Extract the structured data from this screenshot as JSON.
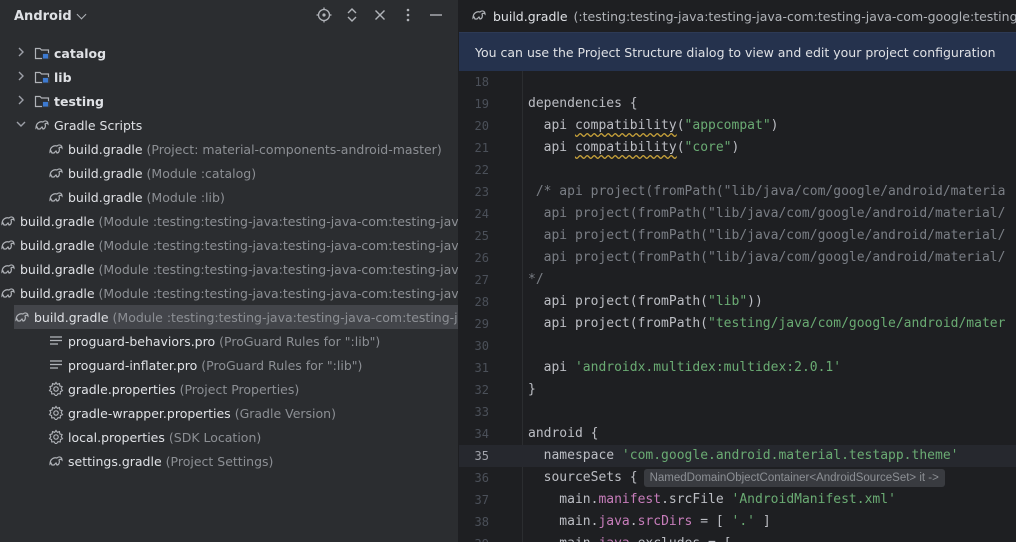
{
  "project_panel": {
    "title": "Android",
    "header_icons": [
      "locate-icon",
      "expand-collapse-icon",
      "close-icon",
      "more-options-icon",
      "minimize-icon"
    ],
    "items": [
      {
        "label": "catalog",
        "hint": "",
        "indent": 0,
        "arrow": "›",
        "icon": "module-folder-icon",
        "bold": true,
        "selected": false
      },
      {
        "label": "lib",
        "hint": "",
        "indent": 0,
        "arrow": "›",
        "icon": "module-folder-icon",
        "bold": true,
        "selected": false
      },
      {
        "label": "testing",
        "hint": "",
        "indent": 0,
        "arrow": "›",
        "icon": "module-folder-icon",
        "bold": true,
        "selected": false
      },
      {
        "label": "Gradle Scripts",
        "hint": "",
        "indent": 0,
        "arrow": "⌄",
        "icon": "gradle-icon",
        "bold": false,
        "selected": false
      },
      {
        "label": "build.gradle",
        "hint": "(Project: material-components-android-master)",
        "indent": 1,
        "arrow": "",
        "icon": "gradle-icon",
        "bold": false,
        "selected": false
      },
      {
        "label": "build.gradle",
        "hint": "(Module :catalog)",
        "indent": 1,
        "arrow": "",
        "icon": "gradle-icon",
        "bold": false,
        "selected": false
      },
      {
        "label": "build.gradle",
        "hint": "(Module :lib)",
        "indent": 1,
        "arrow": "",
        "icon": "gradle-icon",
        "bold": false,
        "selected": false
      },
      {
        "label": "build.gradle",
        "hint": "(Module :testing:testing-java:testing-java-com:testing-java-",
        "indent": 1,
        "arrow": "",
        "icon": "gradle-icon",
        "bold": false,
        "selected": false
      },
      {
        "label": "build.gradle",
        "hint": "(Module :testing:testing-java:testing-java-com:testing-java-",
        "indent": 1,
        "arrow": "",
        "icon": "gradle-icon",
        "bold": false,
        "selected": false
      },
      {
        "label": "build.gradle",
        "hint": "(Module :testing:testing-java:testing-java-com:testing-java-",
        "indent": 1,
        "arrow": "",
        "icon": "gradle-icon",
        "bold": false,
        "selected": false
      },
      {
        "label": "build.gradle",
        "hint": "(Module :testing:testing-java:testing-java-com:testing-java-",
        "indent": 1,
        "arrow": "",
        "icon": "gradle-icon",
        "bold": false,
        "selected": false
      },
      {
        "label": "build.gradle",
        "hint": "(Module :testing:testing-java:testing-java-com:testing-java-",
        "indent": 1,
        "arrow": "",
        "icon": "gradle-icon",
        "bold": false,
        "selected": true
      },
      {
        "label": "proguard-behaviors.pro",
        "hint": "(ProGuard Rules for \":lib\")",
        "indent": 1,
        "arrow": "",
        "icon": "text-file-icon",
        "bold": false,
        "selected": false
      },
      {
        "label": "proguard-inflater.pro",
        "hint": "(ProGuard Rules for \":lib\")",
        "indent": 1,
        "arrow": "",
        "icon": "text-file-icon",
        "bold": false,
        "selected": false
      },
      {
        "label": "gradle.properties",
        "hint": "(Project Properties)",
        "indent": 1,
        "arrow": "",
        "icon": "settings-gear-icon",
        "bold": false,
        "selected": false
      },
      {
        "label": "gradle-wrapper.properties",
        "hint": "(Gradle Version)",
        "indent": 1,
        "arrow": "",
        "icon": "settings-gear-icon",
        "bold": false,
        "selected": false
      },
      {
        "label": "local.properties",
        "hint": "(SDK Location)",
        "indent": 1,
        "arrow": "",
        "icon": "settings-gear-icon",
        "bold": false,
        "selected": false
      },
      {
        "label": "settings.gradle",
        "hint": "(Project Settings)",
        "indent": 1,
        "arrow": "",
        "icon": "gradle-icon",
        "bold": false,
        "selected": false
      }
    ]
  },
  "editor": {
    "tab_title": "build.gradle",
    "tab_path": "(:testing:testing-java:testing-java-com:testing-java-com-google:testing-java-com-goo",
    "banner": "You can use the Project Structure dialog to view and edit your project configuration",
    "current_line": 35,
    "lines": [
      {
        "num": "18",
        "segments": []
      },
      {
        "num": "19",
        "segments": [
          {
            "t": "dependencies {",
            "c": ""
          }
        ]
      },
      {
        "num": "20",
        "segments": [
          {
            "t": "  api ",
            "c": ""
          },
          {
            "t": "compatibility",
            "c": "squig"
          },
          {
            "t": "(",
            "c": ""
          },
          {
            "t": "\"appcompat\"",
            "c": "str"
          },
          {
            "t": ")",
            "c": ""
          }
        ]
      },
      {
        "num": "21",
        "segments": [
          {
            "t": "  api ",
            "c": ""
          },
          {
            "t": "compatibility",
            "c": "squig"
          },
          {
            "t": "(",
            "c": ""
          },
          {
            "t": "\"core\"",
            "c": "str"
          },
          {
            "t": ")",
            "c": ""
          }
        ]
      },
      {
        "num": "22",
        "segments": []
      },
      {
        "num": "23",
        "segments": [
          {
            "t": " /* api project(fromPath(\"lib/java/com/google/android/materia",
            "c": "cmt"
          }
        ]
      },
      {
        "num": "24",
        "segments": [
          {
            "t": "  api project(fromPath(\"lib/java/com/google/android/material/",
            "c": "cmt"
          }
        ]
      },
      {
        "num": "25",
        "segments": [
          {
            "t": "  api project(fromPath(\"lib/java/com/google/android/material/",
            "c": "cmt"
          }
        ]
      },
      {
        "num": "26",
        "segments": [
          {
            "t": "  api project(fromPath(\"lib/java/com/google/android/material/",
            "c": "cmt"
          }
        ]
      },
      {
        "num": "27",
        "segments": [
          {
            "t": "*/",
            "c": "cmt"
          }
        ]
      },
      {
        "num": "28",
        "segments": [
          {
            "t": "  api project(fromPath(",
            "c": ""
          },
          {
            "t": "\"lib\"",
            "c": "str"
          },
          {
            "t": "))",
            "c": ""
          }
        ]
      },
      {
        "num": "29",
        "segments": [
          {
            "t": "  api project(fromPath(",
            "c": ""
          },
          {
            "t": "\"testing/java/com/google/android/mater",
            "c": "str"
          }
        ]
      },
      {
        "num": "30",
        "segments": []
      },
      {
        "num": "31",
        "segments": [
          {
            "t": "  api ",
            "c": ""
          },
          {
            "t": "'androidx.multidex:multidex:2.0.1'",
            "c": "str"
          }
        ]
      },
      {
        "num": "32",
        "segments": [
          {
            "t": "}",
            "c": ""
          }
        ]
      },
      {
        "num": "33",
        "segments": []
      },
      {
        "num": "34",
        "segments": [
          {
            "t": "android {",
            "c": ""
          }
        ]
      },
      {
        "num": "35",
        "segments": [
          {
            "t": "  namespace ",
            "c": ""
          },
          {
            "t": "'com.google.android.material.testapp.theme'",
            "c": "str"
          }
        ]
      },
      {
        "num": "36",
        "segments": [
          {
            "t": "  sourceSets {",
            "c": ""
          }
        ],
        "inlay": "NamedDomainObjectContainer<AndroidSourceSet> it ->"
      },
      {
        "num": "37",
        "segments": [
          {
            "t": "    main.",
            "c": ""
          },
          {
            "t": "manifest",
            "c": "prop"
          },
          {
            "t": ".srcFile ",
            "c": ""
          },
          {
            "t": "'AndroidManifest.xml'",
            "c": "str"
          }
        ]
      },
      {
        "num": "38",
        "segments": [
          {
            "t": "    main.",
            "c": ""
          },
          {
            "t": "java",
            "c": "prop"
          },
          {
            "t": ".",
            "c": ""
          },
          {
            "t": "srcDirs",
            "c": "prop"
          },
          {
            "t": " = [ ",
            "c": ""
          },
          {
            "t": "'.'",
            "c": "str"
          },
          {
            "t": " ]",
            "c": ""
          }
        ]
      },
      {
        "num": "39",
        "segments": [
          {
            "t": "    main.",
            "c": ""
          },
          {
            "t": "java",
            "c": "prop"
          },
          {
            "t": ".excludes = [",
            "c": ""
          }
        ]
      }
    ]
  }
}
